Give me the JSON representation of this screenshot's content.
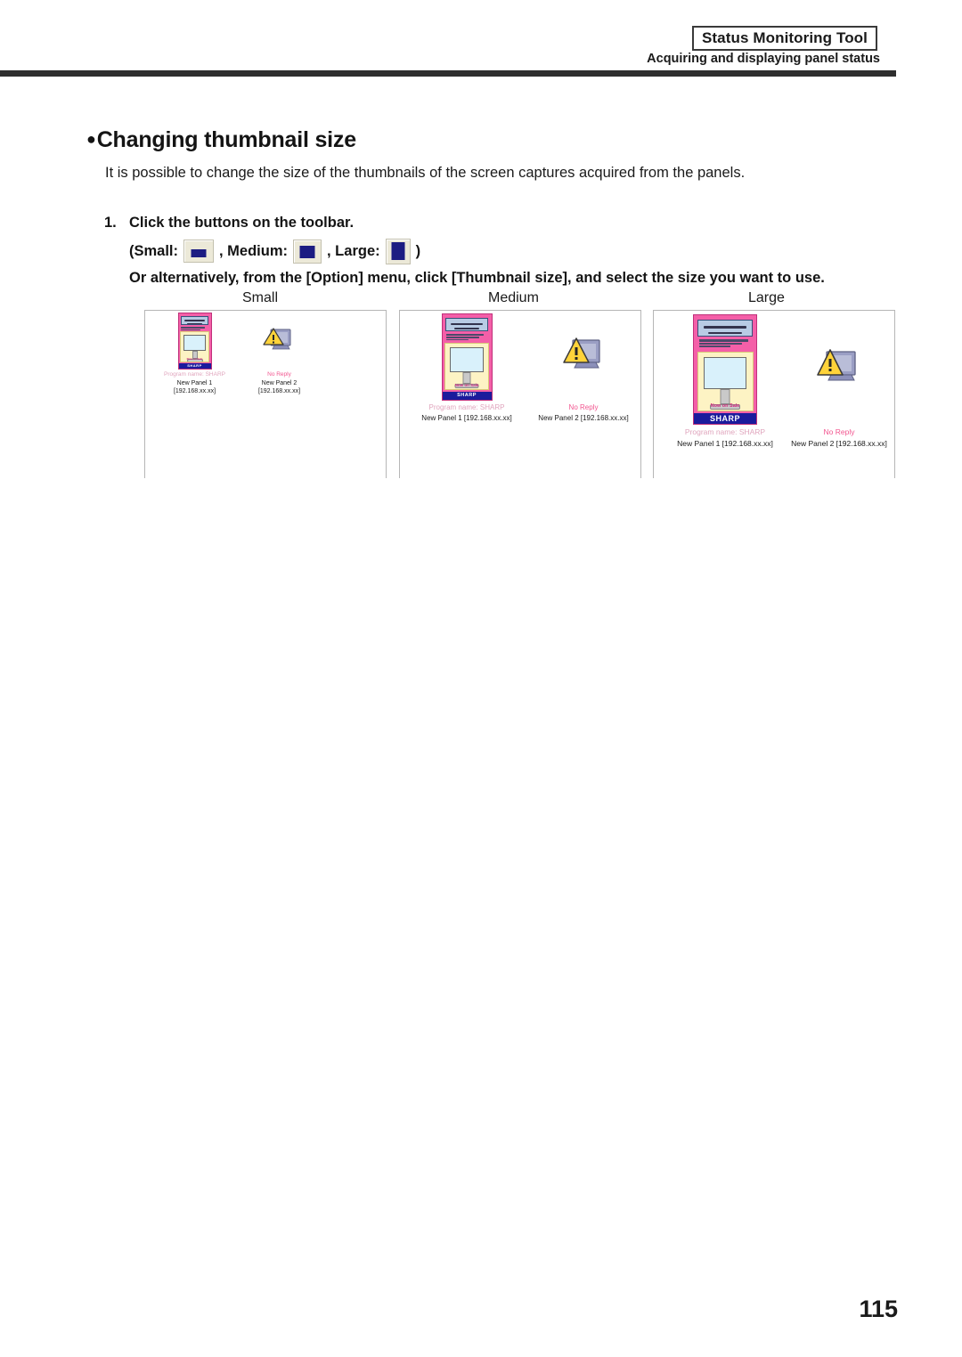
{
  "header": {
    "tool_title": "Status Monitoring Tool",
    "subtitle": "Acquiring and displaying panel status"
  },
  "section": {
    "bullet": "●",
    "heading": "Changing thumbnail size",
    "intro": "It is possible to change the size of the thumbnails of the screen captures acquired from the panels."
  },
  "step": {
    "number": "1.",
    "line1": "Click the buttons on the toolbar.",
    "paren_open": "(Small:",
    "sep_medium": ", Medium:",
    "sep_large": ", Large:",
    "paren_close": ")",
    "line3": "Or alternatively, from the [Option] menu, click [Thumbnail size], and select the size you want to use.",
    "buttons": [
      {
        "name": "small",
        "tooltip": "Small"
      },
      {
        "name": "medium",
        "tooltip": "Medium"
      },
      {
        "name": "large",
        "tooltip": "Large"
      }
    ]
  },
  "demo": {
    "columns": [
      {
        "caption": "Small",
        "items": [
          {
            "capture_header": "Information",
            "capture_mid": "Now on Sale",
            "capture_brand": "SHARP",
            "status": "Program name: SHARP",
            "label_line1": "New Panel 1",
            "label_line2": "[192.168.xx.xx]",
            "label_single": "New Panel 1 [192.168.xx.xx]",
            "kind": "capture"
          },
          {
            "status": "No Reply",
            "label_line1": "New Panel 2",
            "label_line2": "[192.168.xx.xx]",
            "label_single": "New Panel 2 [192.168.xx.xx]",
            "kind": "warning"
          }
        ]
      },
      {
        "caption": "Medium",
        "items": [
          {
            "capture_header": "Information",
            "capture_mid": "Now on Sale",
            "capture_brand": "SHARP",
            "status": "Program name: SHARP",
            "label_single": "New Panel 1 [192.168.xx.xx]",
            "kind": "capture"
          },
          {
            "status": "No Reply",
            "label_single": "New Panel 2 [192.168.xx.xx]",
            "kind": "warning"
          }
        ]
      },
      {
        "caption": "Large",
        "items": [
          {
            "capture_header": "Information",
            "capture_mid": "Now on Sale",
            "capture_brand": "SHARP",
            "status": "Program name: SHARP",
            "label_single": "New Panel 1 [192.168.xx.xx]",
            "kind": "capture"
          },
          {
            "status": "No Reply",
            "label_single": "New Panel 2 [192.168.xx.xx]",
            "kind": "warning"
          }
        ]
      }
    ]
  },
  "footer": {
    "page_number": "115"
  },
  "colors": {
    "rule": "#2e2e2e",
    "button_face": "#ece9d8",
    "button_square": "#1c1c82",
    "capture_frame": "#f45fa8",
    "brand_bar": "#1b1b9c",
    "status_pink": "#f2558f",
    "warn_yellow": "#ffd33a"
  }
}
